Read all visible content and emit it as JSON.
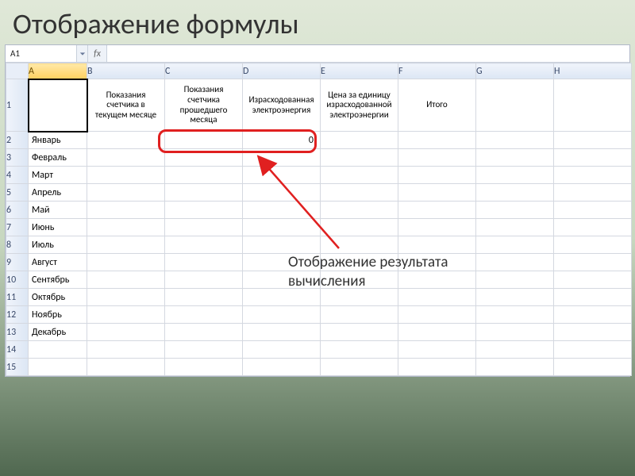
{
  "title": "Отображение формулы",
  "name_box": "A1",
  "fx": "fx",
  "columns": [
    "A",
    "B",
    "C",
    "D",
    "E",
    "F",
    "G",
    "H"
  ],
  "selected_col": "A",
  "row_count": 15,
  "header_row": {
    "B": "Показания счетчика в текущем месяце",
    "C": "Показания счетчика прошедшего месяца",
    "D": "Израсходованная электроэнергия",
    "E": "Цена за единицу израсходованной электроэнергии",
    "F": "Итого"
  },
  "months": [
    "Январь",
    "Февраль",
    "Март",
    "Апрель",
    "Май",
    "Июнь",
    "Июль",
    "Август",
    "Сентябрь",
    "Октябрь",
    "Ноябрь",
    "Декабрь"
  ],
  "d2_value": "0",
  "annotation": "Отображение результата вычисления"
}
